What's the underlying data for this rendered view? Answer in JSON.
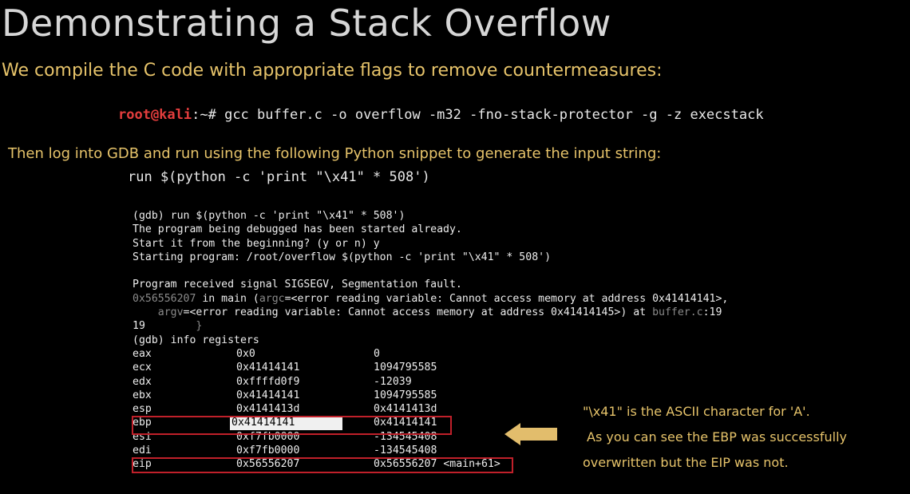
{
  "title": "Demonstrating a Stack Overflow",
  "subtitle": "We compile the C code with appropriate flags to remove countermeasures:",
  "compile": {
    "prompt_user": "root@kali",
    "prompt_path": ":~# ",
    "command": "gcc buffer.c -o overflow -m32 -fno-stack-protector -g -z execstack"
  },
  "gdb_intro": "Then log into GDB and run using the following Python snippet to generate the input string:",
  "python_snippet": "run $(python -c 'print \"\\x41\" * 508')",
  "gdb_output": {
    "lines_top": [
      "(gdb) run $(python -c 'print \"\\x41\" * 508')",
      "The program being debugged has been started already.",
      "Start it from the beginning? (y or n) y",
      "Starting program: /root/overflow $(python -c 'print \"\\x41\" * 508')"
    ],
    "signal_line": "Program received signal SIGSEGV, Segmentation fault.",
    "frame_line1_addr": "0x56556207",
    "frame_line1_mid": " in main (",
    "frame_line1_argc": "argc",
    "frame_line1_rest": "=<error reading variable: Cannot access memory at address 0x41414141>,",
    "frame_line2_indent": "    ",
    "frame_line2_argv": "argv",
    "frame_line2_rest": "=<error reading variable: Cannot access memory at address 0x41414145>) at ",
    "frame_line2_file": "buffer.c",
    "frame_line2_lineno": ":19",
    "source_lineno": "19",
    "source_code": "        }",
    "info_cmd": "(gdb) info registers",
    "registers": [
      {
        "name": "eax",
        "hex": "0x0",
        "val": "0"
      },
      {
        "name": "ecx",
        "hex": "0x41414141",
        "val": "1094795585"
      },
      {
        "name": "edx",
        "hex": "0xffffd0f9",
        "val": "-12039"
      },
      {
        "name": "ebx",
        "hex": "0x41414141",
        "val": "1094795585"
      },
      {
        "name": "esp",
        "hex": "0x4141413d",
        "val": "0x4141413d"
      },
      {
        "name": "ebp",
        "hex": "0x41414141",
        "val": "0x41414141"
      },
      {
        "name": "esi",
        "hex": "0xf7fb0000",
        "val": "-134545408"
      },
      {
        "name": "edi",
        "hex": "0xf7fb0000",
        "val": "-134545408"
      },
      {
        "name": "eip",
        "hex": "0x56556207",
        "val": "0x56556207 <main+61>"
      }
    ]
  },
  "note": {
    "line1": "\"\\x41\" is the ASCII character for 'A'.",
    "line2": "As you can see the EBP was successfully",
    "line3": "overwritten but the EIP was not."
  },
  "colors": {
    "accent_gold": "#e6c36a",
    "root_red": "#e33d3d",
    "highlight_red": "#c0202a",
    "arrow_gold": "#e2bd6c"
  },
  "icons": {
    "arrow": "left-arrow-icon"
  }
}
